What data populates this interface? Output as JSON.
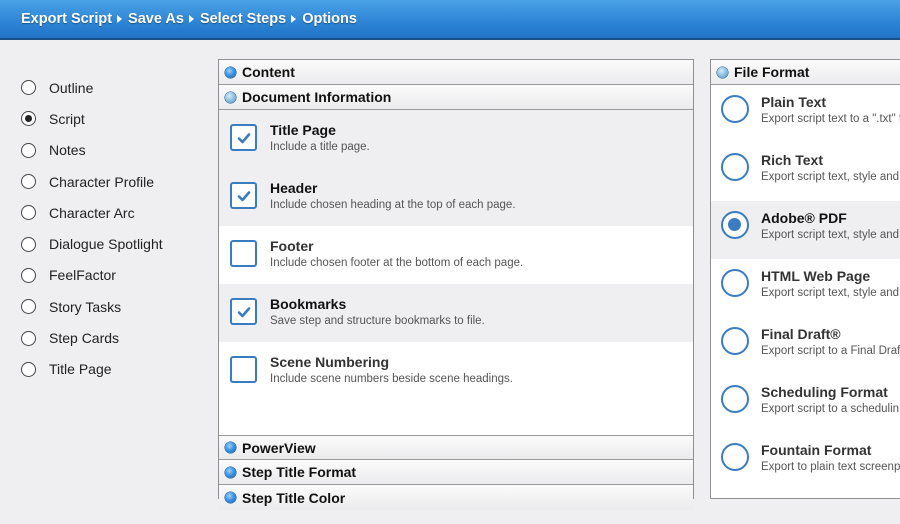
{
  "breadcrumb": [
    "Export Script",
    "Save As",
    "Select Steps",
    "Options"
  ],
  "left_list": {
    "selected": "Script",
    "items": [
      "Outline",
      "Script",
      "Notes",
      "Character Profile",
      "Character Arc",
      "Dialogue Spotlight",
      "FeelFactor",
      "Story Tasks",
      "Step Cards",
      "Title Page"
    ]
  },
  "middle": {
    "sections_top": [
      {
        "title": "Content",
        "expanded": false
      },
      {
        "title": "Document Information",
        "expanded": true
      }
    ],
    "options": [
      {
        "title": "Title Page",
        "desc": "Include a title page.",
        "checked": true
      },
      {
        "title": "Header",
        "desc": "Include chosen heading at the top of each page.",
        "checked": true
      },
      {
        "title": "Footer",
        "desc": "Include chosen footer at the bottom of each page.",
        "checked": false
      },
      {
        "title": "Bookmarks",
        "desc": "Save step and structure bookmarks to file.",
        "checked": true
      },
      {
        "title": "Scene Numbering",
        "desc": "Include scene numbers beside scene headings.",
        "checked": false
      }
    ],
    "sections_bottom": [
      {
        "title": "PowerView",
        "expanded": false
      },
      {
        "title": "Step Title Format",
        "expanded": false
      },
      {
        "title": "Step Title Color",
        "expanded": false
      }
    ]
  },
  "file_format": {
    "title": "File Format",
    "selected": "Adobe® PDF",
    "options": [
      {
        "title": "Plain Text",
        "desc": "Export script text to a \".txt\" f"
      },
      {
        "title": "Rich Text",
        "desc": "Export script text, style and"
      },
      {
        "title": "Adobe® PDF",
        "desc": "Export script text, style and"
      },
      {
        "title": "HTML Web Page",
        "desc": "Export script text, style and"
      },
      {
        "title": "Final Draft®",
        "desc": "Export script to a Final Draf"
      },
      {
        "title": "Scheduling Format",
        "desc": "Export script to a schedulin"
      },
      {
        "title": "Fountain Format",
        "desc": "Export to plain text screenp"
      }
    ]
  },
  "colors": {
    "accent": "#3a7cc1",
    "topbar": "#2f86d6"
  }
}
